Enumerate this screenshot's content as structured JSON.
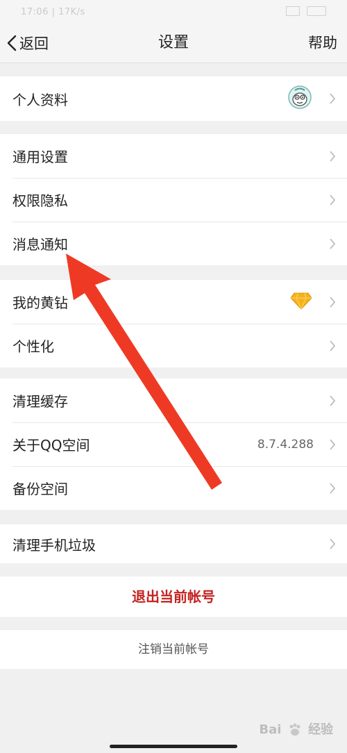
{
  "status_bar": {
    "time": "17:06 | 17K/s"
  },
  "nav": {
    "back_label": "返回",
    "title": "设置",
    "help_label": "帮助"
  },
  "groups": [
    [
      {
        "label": "个人资料",
        "trailing": "avatar-icon"
      }
    ],
    [
      {
        "label": "通用设置"
      },
      {
        "label": "权限隐私"
      },
      {
        "label": "消息通知"
      }
    ],
    [
      {
        "label": "我的黄钻",
        "trailing": "diamond-icon"
      },
      {
        "label": "个性化"
      }
    ],
    [
      {
        "label": "清理缓存"
      },
      {
        "label": "关于QQ空间",
        "value": "8.7.4.288"
      },
      {
        "label": "备份空间"
      }
    ],
    [
      {
        "label": "清理手机垃圾"
      }
    ]
  ],
  "actions": {
    "logout": "退出当前帐号",
    "cancel_account": "注销当前帐号"
  },
  "watermark": {
    "text_left": "Bai",
    "text_right": "经验"
  },
  "colors": {
    "accent_red": "#c4221f",
    "arrow_red": "#ee3a24",
    "diamond": "#f5b21b"
  }
}
